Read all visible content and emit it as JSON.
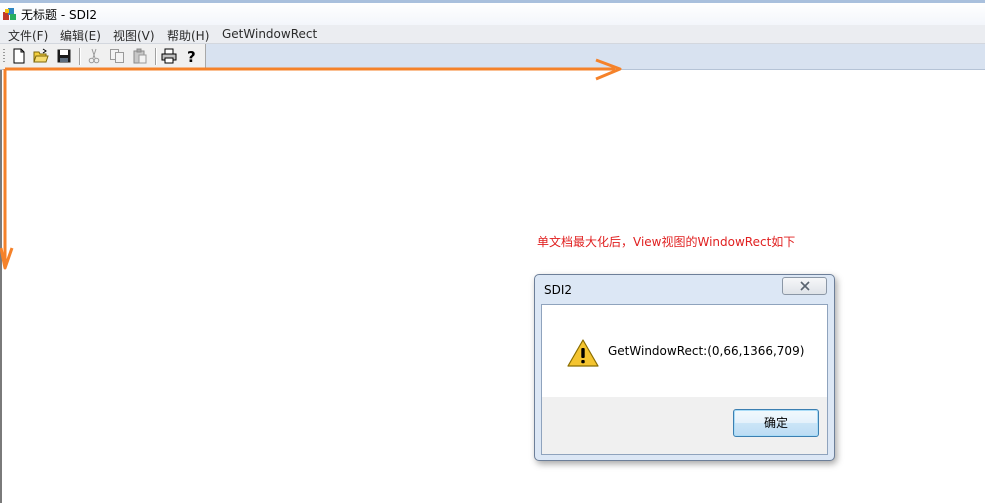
{
  "window": {
    "title": "无标题 - SDI2"
  },
  "menu": [
    {
      "label": "文件(F)"
    },
    {
      "label": "编辑(E)"
    },
    {
      "label": "视图(V)"
    },
    {
      "label": "帮助(H)"
    },
    {
      "label": "GetWindowRect"
    }
  ],
  "toolbar": {
    "buttons": [
      {
        "icon": "new-file-icon",
        "enabled": true
      },
      {
        "icon": "open-folder-icon",
        "enabled": true
      },
      {
        "icon": "save-icon",
        "enabled": true
      },
      {
        "icon": "cut-icon",
        "enabled": false
      },
      {
        "icon": "copy-icon",
        "enabled": false
      },
      {
        "icon": "paste-icon",
        "enabled": false
      },
      {
        "icon": "print-icon",
        "enabled": true
      },
      {
        "icon": "help-icon",
        "enabled": true
      }
    ]
  },
  "annotation": {
    "note": "单文档最大化后，View视图的WindowRect如下",
    "note_color": "#e02020",
    "arrow_color": "#f5822a"
  },
  "dialog": {
    "title": "SDI2",
    "message": "GetWindowRect:(0,66,1366,709)",
    "ok_label": "确定",
    "icon": "warning-icon"
  }
}
